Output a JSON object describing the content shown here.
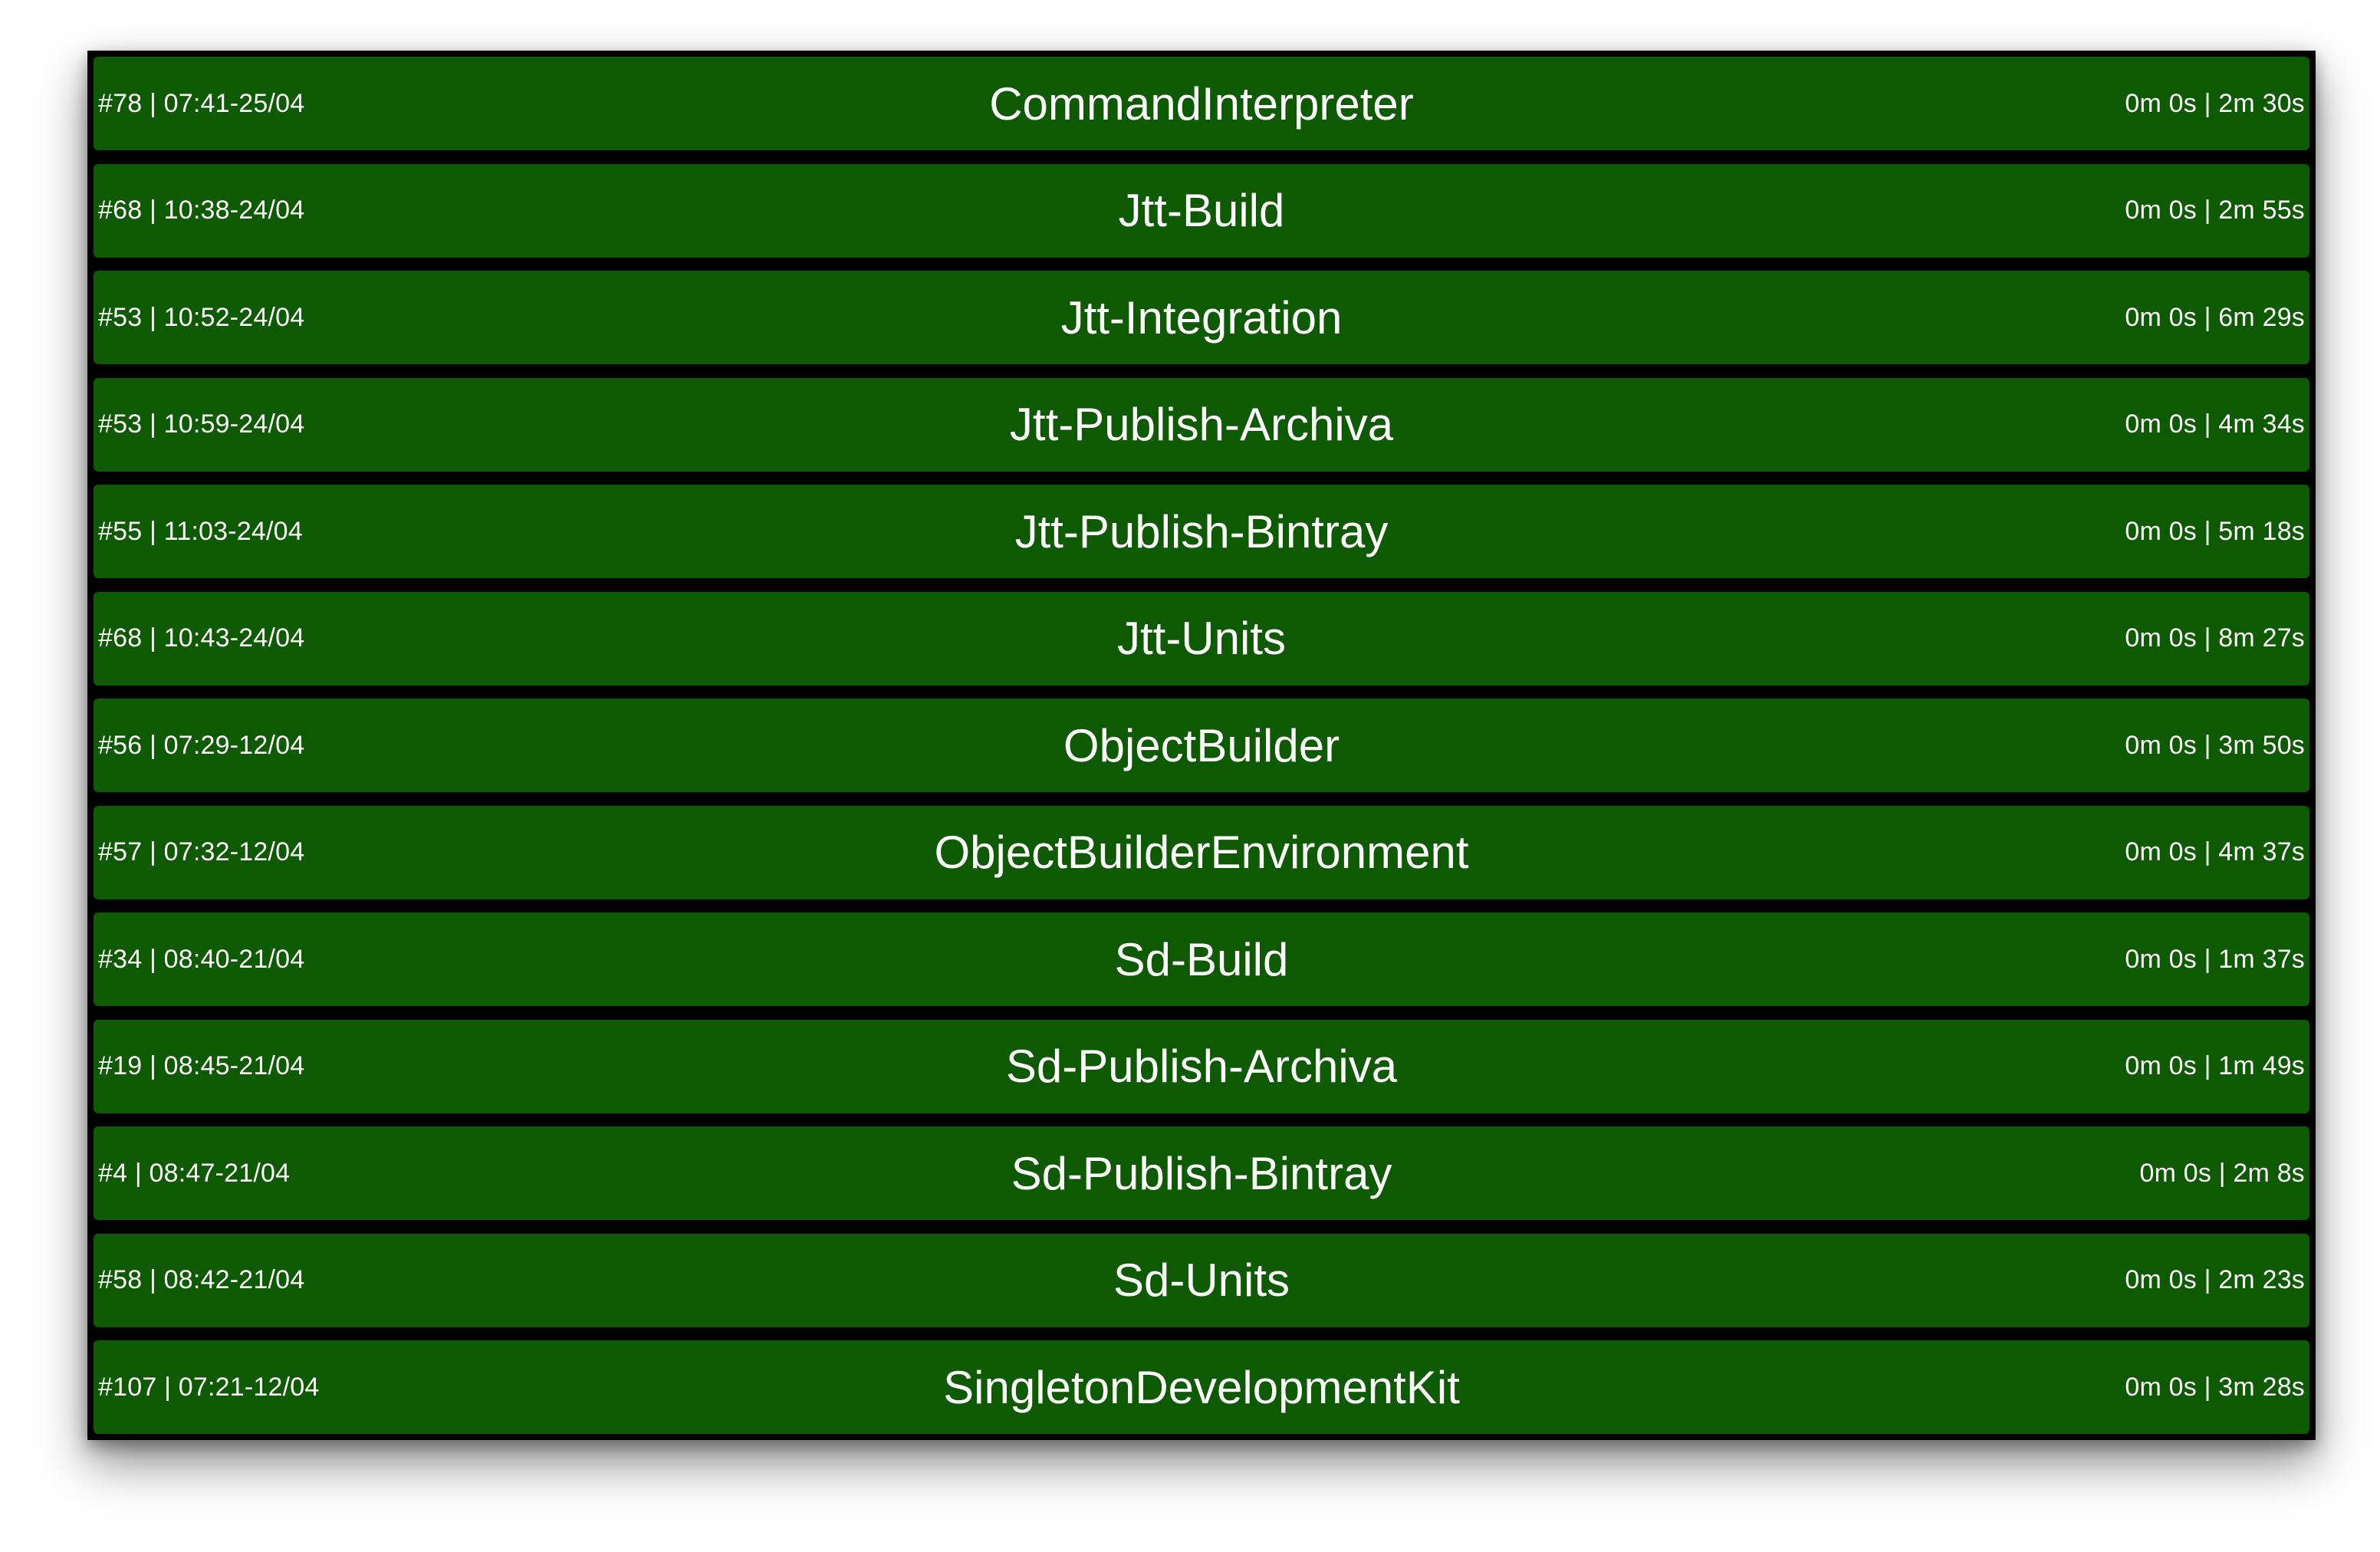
{
  "theme": {
    "success_color": "#0d5a00",
    "background_color": "#000000",
    "text_color": "#ffffff"
  },
  "jobs": [
    {
      "meta": "#78 | 07:41-25/04",
      "name": "CommandInterpreter",
      "duration": "0m 0s | 2m 30s"
    },
    {
      "meta": "#68 | 10:38-24/04",
      "name": "Jtt-Build",
      "duration": "0m 0s | 2m 55s"
    },
    {
      "meta": "#53 | 10:52-24/04",
      "name": "Jtt-Integration",
      "duration": "0m 0s | 6m 29s"
    },
    {
      "meta": "#53 | 10:59-24/04",
      "name": "Jtt-Publish-Archiva",
      "duration": "0m 0s | 4m 34s"
    },
    {
      "meta": "#55 | 11:03-24/04",
      "name": "Jtt-Publish-Bintray",
      "duration": "0m 0s | 5m 18s"
    },
    {
      "meta": "#68 | 10:43-24/04",
      "name": "Jtt-Units",
      "duration": "0m 0s | 8m 27s"
    },
    {
      "meta": "#56 | 07:29-12/04",
      "name": "ObjectBuilder",
      "duration": "0m 0s | 3m 50s"
    },
    {
      "meta": "#57 | 07:32-12/04",
      "name": "ObjectBuilderEnvironment",
      "duration": "0m 0s | 4m 37s"
    },
    {
      "meta": "#34 | 08:40-21/04",
      "name": "Sd-Build",
      "duration": "0m 0s | 1m 37s"
    },
    {
      "meta": "#19 | 08:45-21/04",
      "name": "Sd-Publish-Archiva",
      "duration": "0m 0s | 1m 49s"
    },
    {
      "meta": "#4 | 08:47-21/04",
      "name": "Sd-Publish-Bintray",
      "duration": "0m 0s | 2m 8s"
    },
    {
      "meta": "#58 | 08:42-21/04",
      "name": "Sd-Units",
      "duration": "0m 0s | 2m 23s"
    },
    {
      "meta": "#107 | 07:21-12/04",
      "name": "SingletonDevelopmentKit",
      "duration": "0m 0s | 3m 28s"
    }
  ]
}
